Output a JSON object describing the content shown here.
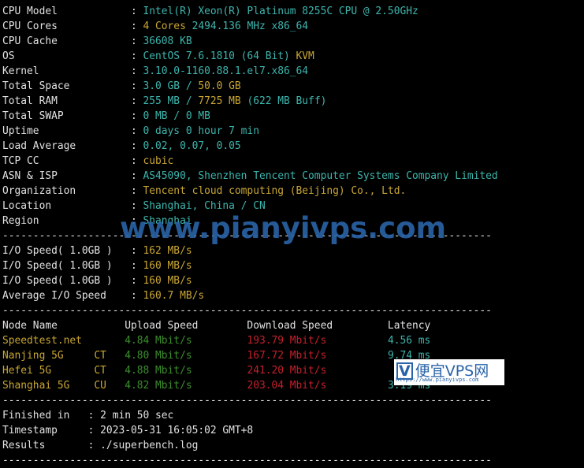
{
  "colors": {
    "white": "#e2e2e2",
    "cyan": "#3db5ad",
    "yellow": "#c9a634",
    "green": "#3b8e2c",
    "red": "#c4202c",
    "watermark": "#2a64a8"
  },
  "lines": [
    [
      [
        "w",
        "CPU Model            : "
      ],
      [
        "c",
        "Intel(R) Xeon(R) Platinum 8255C CPU @ 2.50GHz"
      ]
    ],
    [
      [
        "w",
        "CPU Cores            : "
      ],
      [
        "y",
        "4 Cores "
      ],
      [
        "c",
        "2494.136 MHz x86_64"
      ]
    ],
    [
      [
        "w",
        "CPU Cache            : "
      ],
      [
        "c",
        "36608 KB"
      ]
    ],
    [
      [
        "w",
        "OS                   : "
      ],
      [
        "c",
        "CentOS 7.6.1810 (64 Bit) "
      ],
      [
        "y",
        "KVM"
      ]
    ],
    [
      [
        "w",
        "Kernel               : "
      ],
      [
        "c",
        "3.10.0-1160.88.1.el7.x86_64"
      ]
    ],
    [
      [
        "w",
        "Total Space          : "
      ],
      [
        "c",
        "3.0 GB / "
      ],
      [
        "y",
        "50.0 GB"
      ]
    ],
    [
      [
        "w",
        "Total RAM            : "
      ],
      [
        "c",
        "255 MB / "
      ],
      [
        "y",
        "7725 MB "
      ],
      [
        "c",
        "(622 MB Buff)"
      ]
    ],
    [
      [
        "w",
        "Total SWAP           : "
      ],
      [
        "c",
        "0 MB / 0 MB"
      ]
    ],
    [
      [
        "w",
        "Uptime               : "
      ],
      [
        "c",
        "0 days 0 hour 7 min"
      ]
    ],
    [
      [
        "w",
        "Load Average         : "
      ],
      [
        "c",
        "0.02, 0.07, 0.05"
      ]
    ],
    [
      [
        "w",
        "TCP CC               : "
      ],
      [
        "y",
        "cubic"
      ]
    ],
    [
      [
        "w",
        "ASN & ISP            : "
      ],
      [
        "c",
        "AS45090, Shenzhen Tencent Computer Systems Company Limited"
      ]
    ],
    [
      [
        "w",
        "Organization         : "
      ],
      [
        "y",
        "Tencent cloud computing (Beijing) Co., Ltd."
      ]
    ],
    [
      [
        "w",
        "Location             : "
      ],
      [
        "c",
        "Shanghai, China / CN"
      ]
    ],
    [
      [
        "w",
        "Region               : "
      ],
      [
        "c",
        "Shanghai"
      ]
    ],
    [
      [
        "w",
        "--------------------------------------------------------------------------------"
      ]
    ],
    [
      [
        "w",
        "I/O Speed( 1.0GB )   : "
      ],
      [
        "y",
        "162 MB/s"
      ]
    ],
    [
      [
        "w",
        "I/O Speed( 1.0GB )   : "
      ],
      [
        "y",
        "160 MB/s"
      ]
    ],
    [
      [
        "w",
        "I/O Speed( 1.0GB )   : "
      ],
      [
        "y",
        "160 MB/s"
      ]
    ],
    [
      [
        "w",
        "Average I/O Speed    : "
      ],
      [
        "y",
        "160.7 MB/s"
      ]
    ],
    [
      [
        "w",
        "--------------------------------------------------------------------------------"
      ]
    ],
    [
      [
        "w",
        "Node Name           Upload Speed        Download Speed         Latency"
      ]
    ],
    [
      [
        "y",
        "Speedtest.net       "
      ],
      [
        "g",
        "4.84 Mbit/s         "
      ],
      [
        "r",
        "193.79 Mbit/s          "
      ],
      [
        "c",
        "4.56 ms"
      ]
    ],
    [
      [
        "y",
        "Nanjing 5G     CT   "
      ],
      [
        "g",
        "4.80 Mbit/s         "
      ],
      [
        "r",
        "167.72 Mbit/s          "
      ],
      [
        "c",
        "9.74 ms"
      ]
    ],
    [
      [
        "y",
        "Hefei 5G       CT   "
      ],
      [
        "g",
        "4.88 Mbit/s         "
      ],
      [
        "r",
        "241.20 Mbit/s          "
      ],
      [
        "c",
        "       "
      ]
    ],
    [
      [
        "y",
        "Shanghai 5G    CU   "
      ],
      [
        "g",
        "4.82 Mbit/s         "
      ],
      [
        "r",
        "203.04 Mbit/s          "
      ],
      [
        "c",
        "3.19 ms"
      ]
    ],
    [
      [
        "w",
        "--------------------------------------------------------------------------------"
      ]
    ],
    [
      [
        "w",
        "Finished in   : 2 min 50 sec"
      ]
    ],
    [
      [
        "w",
        "Timestamp     : 2023-05-31 16:05:02 GMT+8"
      ]
    ],
    [
      [
        "w",
        "Results       : ./superbench.log"
      ]
    ],
    [
      [
        "w",
        "--------------------------------------------------------------------------------"
      ]
    ]
  ],
  "watermark": {
    "text": "www.pianyivps.com",
    "logo_letter": "V",
    "logo_title": "便宜VPS网",
    "logo_url": "https://www.pianyivps.com"
  }
}
